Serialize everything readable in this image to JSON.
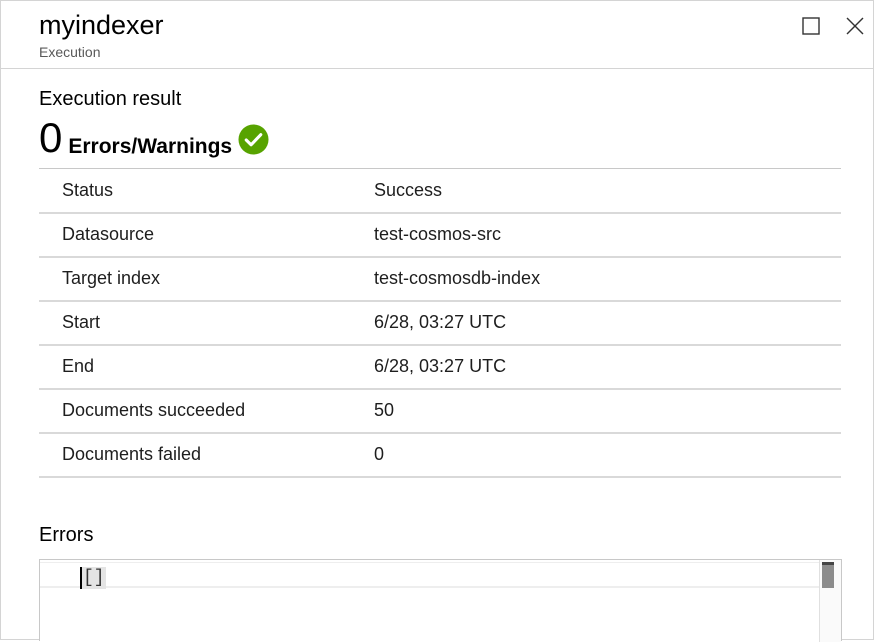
{
  "header": {
    "title": "myindexer",
    "subtitle": "Execution"
  },
  "execution": {
    "section_title": "Execution result",
    "count": "0",
    "count_label": "Errors/Warnings",
    "status_color": "#57a300"
  },
  "details": [
    {
      "key": "Status",
      "value": "Success"
    },
    {
      "key": "Datasource",
      "value": "test-cosmos-src"
    },
    {
      "key": "Target index",
      "value": "test-cosmosdb-index"
    },
    {
      "key": "Start",
      "value": "6/28, 03:27 UTC"
    },
    {
      "key": "End",
      "value": "6/28, 03:27 UTC"
    },
    {
      "key": "Documents succeeded",
      "value": "50"
    },
    {
      "key": "Documents failed",
      "value": "0"
    }
  ],
  "errors": {
    "section_title": "Errors",
    "content": "[]"
  },
  "icons": {
    "maximize": "maximize-icon",
    "close": "close-icon",
    "status": "check-circle-icon"
  }
}
